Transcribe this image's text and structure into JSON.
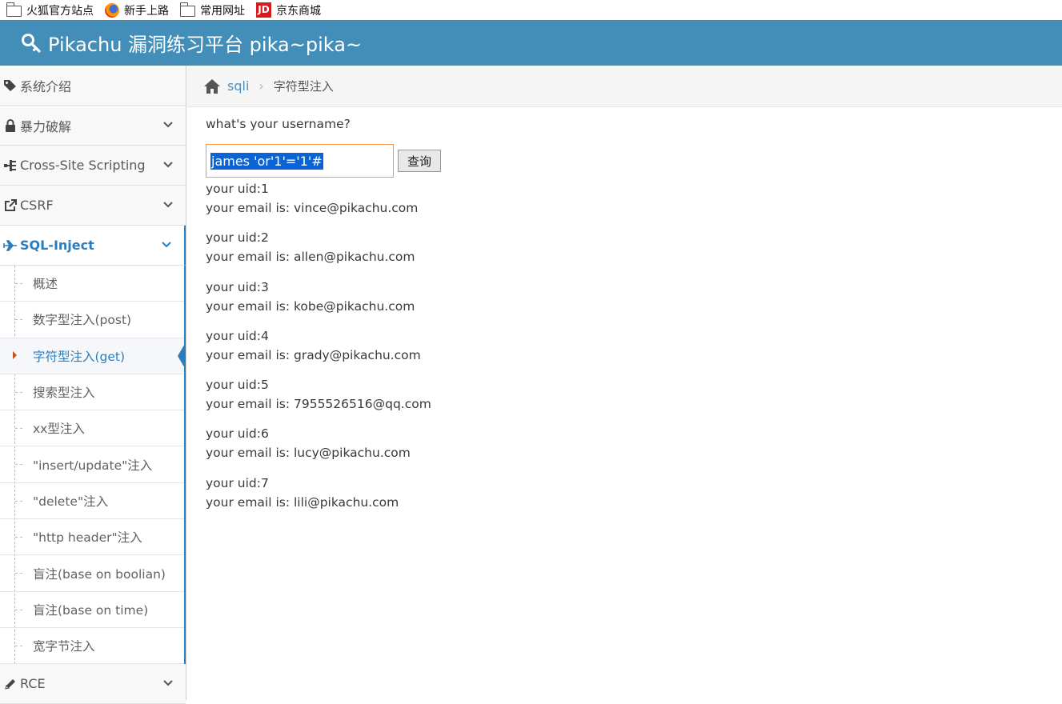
{
  "bookmarks": [
    {
      "label": "火狐官方站点",
      "icon": "folder-icon"
    },
    {
      "label": "新手上路",
      "icon": "firefox-icon"
    },
    {
      "label": "常用网址",
      "icon": "folder-icon"
    },
    {
      "label": "京东商城",
      "icon": "jd-icon",
      "icon_text": "JD"
    }
  ],
  "header": {
    "title": "Pikachu 漏洞练习平台 pika~pika~",
    "icon": "key-icon"
  },
  "sidebar": {
    "items": [
      {
        "label": "系统介绍",
        "icon": "tags-icon"
      },
      {
        "label": "暴力破解",
        "icon": "lock-icon"
      },
      {
        "label": "Cross-Site Scripting",
        "icon": "sitemap-icon"
      },
      {
        "label": "CSRF",
        "icon": "share-icon"
      },
      {
        "label": "SQL-Inject",
        "icon": "plane-icon"
      },
      {
        "label": "RCE",
        "icon": "pencil-icon"
      }
    ],
    "sql_submenu": [
      "概述",
      "数字型注入(post)",
      "字符型注入(get)",
      "搜索型注入",
      "xx型注入",
      "\"insert/update\"注入",
      "\"delete\"注入",
      "\"http header\"注入",
      "盲注(base on boolian)",
      "盲注(base on time)",
      "宽字节注入"
    ]
  },
  "breadcrumb": {
    "link": "sqli",
    "current": "字符型注入"
  },
  "form": {
    "question": "what's your username?",
    "input_value": "james 'or'1'='1'#",
    "button_label": "查询"
  },
  "results": [
    {
      "uid": "your uid:1",
      "email": "your email is: vince@pikachu.com"
    },
    {
      "uid": "your uid:2",
      "email": "your email is: allen@pikachu.com"
    },
    {
      "uid": "your uid:3",
      "email": "your email is: kobe@pikachu.com"
    },
    {
      "uid": "your uid:4",
      "email": "your email is: grady@pikachu.com"
    },
    {
      "uid": "your uid:5",
      "email": "your email is: 7955526516@qq.com"
    },
    {
      "uid": "your uid:6",
      "email": "your email is: lucy@pikachu.com"
    },
    {
      "uid": "your uid:7",
      "email": "your email is: lili@pikachu.com"
    }
  ],
  "colors": {
    "header": "#438eb9",
    "accent": "#2b7dbc",
    "input_border": "#f59942",
    "selection": "#0a64d6"
  }
}
